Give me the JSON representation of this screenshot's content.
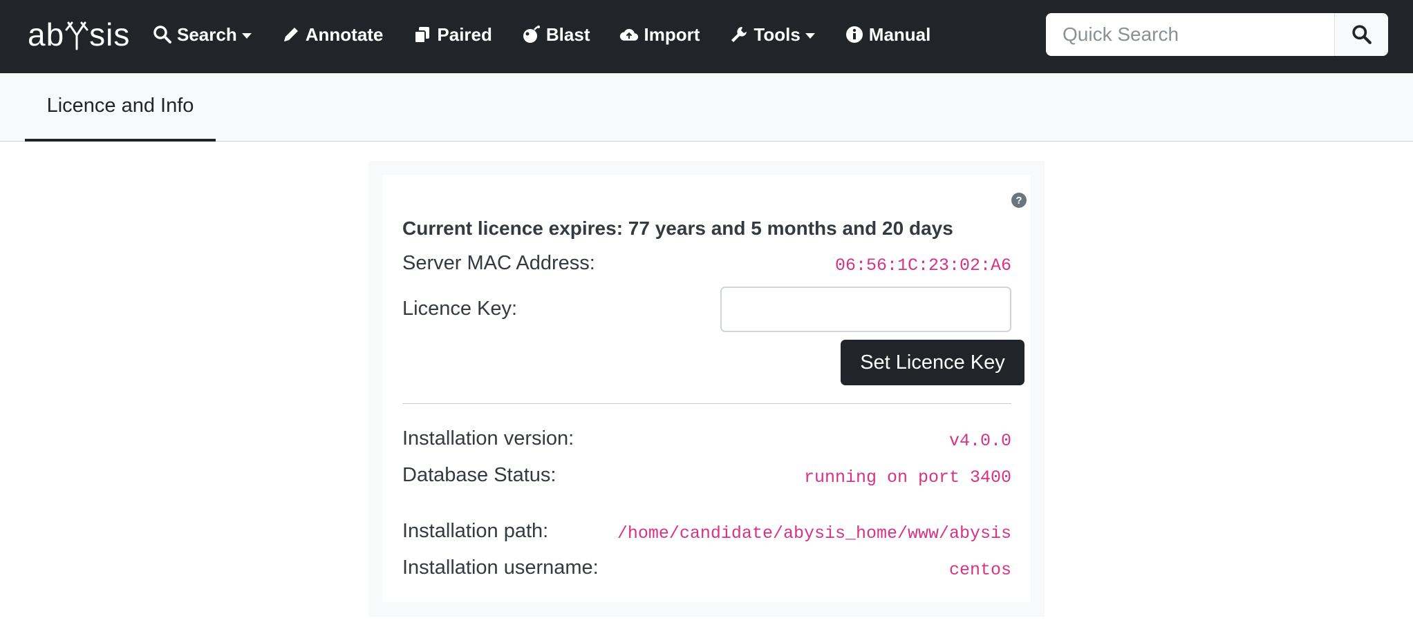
{
  "app": {
    "logo_text_a": "ab",
    "logo_text_b": "sis"
  },
  "nav": {
    "items": [
      {
        "label": "Search",
        "icon": "search-icon",
        "dropdown": true
      },
      {
        "label": "Annotate",
        "icon": "pencil-icon",
        "dropdown": false
      },
      {
        "label": "Paired",
        "icon": "copy-icon",
        "dropdown": false
      },
      {
        "label": "Blast",
        "icon": "bomb-icon",
        "dropdown": false
      },
      {
        "label": "Import",
        "icon": "cloud-upload-icon",
        "dropdown": false
      },
      {
        "label": "Tools",
        "icon": "wrench-icon",
        "dropdown": true
      },
      {
        "label": "Manual",
        "icon": "info-circle-icon",
        "dropdown": false
      }
    ],
    "quick_search": {
      "placeholder": "Quick Search",
      "value": ""
    }
  },
  "tabs": [
    {
      "label": "Licence and Info",
      "active": true
    }
  ],
  "licence": {
    "expiry_text": "Current licence expires: 77 years and 5 months and 20 days",
    "mac_label": "Server MAC Address:",
    "mac_value": "06:56:1C:23:02:A6",
    "key_label": "Licence Key:",
    "key_value": "",
    "set_button": "Set Licence Key",
    "help_glyph": "?"
  },
  "info": {
    "version_label": "Installation version:",
    "version_value": "v4.0.0",
    "db_label": "Database Status:",
    "db_value": "running on port 3400",
    "path_label": "Installation path:",
    "path_value": "/home/candidate/abysis_home/www/abysis",
    "user_label": "Installation username:",
    "user_value": "centos"
  },
  "colors": {
    "navbar_bg": "#212529",
    "subbar_bg": "#f8f9fa",
    "code_pink": "#d63384",
    "button_dark": "#212529"
  }
}
